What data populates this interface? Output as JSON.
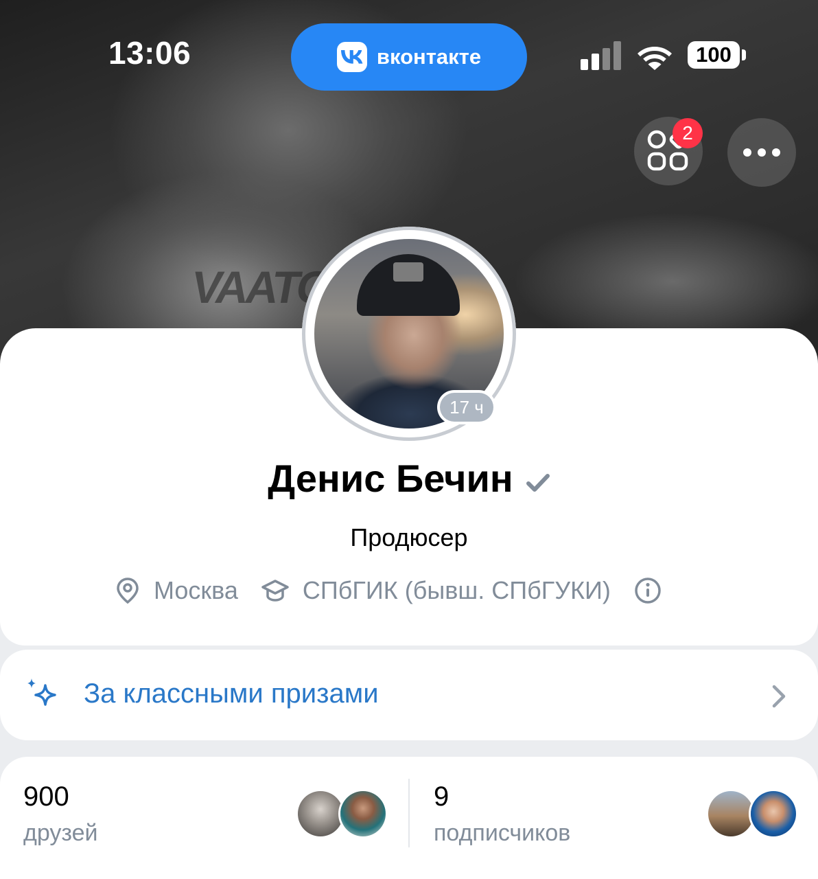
{
  "status_bar": {
    "time": "13:06",
    "app_pill": "вконтакте",
    "battery": "100"
  },
  "header": {
    "services_badge": "2"
  },
  "profile": {
    "name": "Денис Бечин",
    "story_time": "17 ч",
    "status": "Продюсер",
    "city": "Москва",
    "education": "СПбГИК (бывш. СПбГУКИ)"
  },
  "promo": {
    "label": "За классными призами"
  },
  "counters": {
    "friends_count": "900",
    "friends_label": "друзей",
    "subscribers_count": "9",
    "subscribers_label": "подписчиков"
  },
  "colors": {
    "vk_blue": "#2787f5",
    "link_blue": "#2a78c8",
    "secondary_text": "#818c99",
    "badge_red": "#ff3347"
  }
}
